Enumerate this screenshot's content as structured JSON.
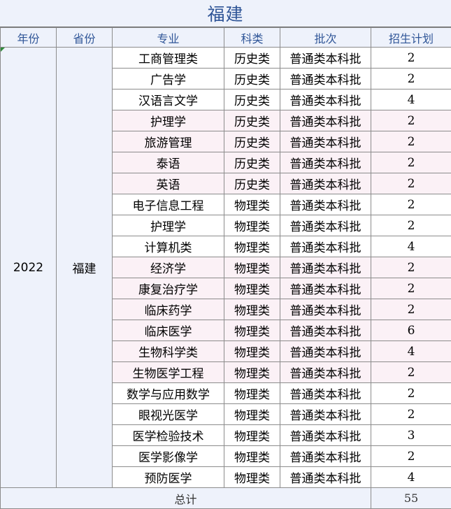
{
  "title": "福建",
  "headers": [
    "年份",
    "省份",
    "专业",
    "科类",
    "批次",
    "招生计划"
  ],
  "year": "2022",
  "province": "福建",
  "rows": [
    {
      "major": "工商管理类",
      "category": "历史类",
      "batch": "普通类本科批",
      "plan": "2",
      "shade": "white"
    },
    {
      "major": "广告学",
      "category": "历史类",
      "batch": "普通类本科批",
      "plan": "2",
      "shade": "white"
    },
    {
      "major": "汉语言文学",
      "category": "历史类",
      "batch": "普通类本科批",
      "plan": "4",
      "shade": "white"
    },
    {
      "major": "护理学",
      "category": "历史类",
      "batch": "普通类本科批",
      "plan": "2",
      "shade": "pink"
    },
    {
      "major": "旅游管理",
      "category": "历史类",
      "batch": "普通类本科批",
      "plan": "2",
      "shade": "pink"
    },
    {
      "major": "泰语",
      "category": "历史类",
      "batch": "普通类本科批",
      "plan": "2",
      "shade": "pink"
    },
    {
      "major": "英语",
      "category": "历史类",
      "batch": "普通类本科批",
      "plan": "2",
      "shade": "pink"
    },
    {
      "major": "电子信息工程",
      "category": "物理类",
      "batch": "普通类本科批",
      "plan": "2",
      "shade": "white"
    },
    {
      "major": "护理学",
      "category": "物理类",
      "batch": "普通类本科批",
      "plan": "2",
      "shade": "white"
    },
    {
      "major": "计算机类",
      "category": "物理类",
      "batch": "普通类本科批",
      "plan": "4",
      "shade": "white"
    },
    {
      "major": "经济学",
      "category": "物理类",
      "batch": "普通类本科批",
      "plan": "2",
      "shade": "pink"
    },
    {
      "major": "康复治疗学",
      "category": "物理类",
      "batch": "普通类本科批",
      "plan": "2",
      "shade": "pink"
    },
    {
      "major": "临床药学",
      "category": "物理类",
      "batch": "普通类本科批",
      "plan": "2",
      "shade": "pink"
    },
    {
      "major": "临床医学",
      "category": "物理类",
      "batch": "普通类本科批",
      "plan": "6",
      "shade": "pink"
    },
    {
      "major": "生物科学类",
      "category": "物理类",
      "batch": "普通类本科批",
      "plan": "4",
      "shade": "pink"
    },
    {
      "major": "生物医学工程",
      "category": "物理类",
      "batch": "普通类本科批",
      "plan": "2",
      "shade": "pink"
    },
    {
      "major": "数学与应用数学",
      "category": "物理类",
      "batch": "普通类本科批",
      "plan": "2",
      "shade": "white"
    },
    {
      "major": "眼视光医学",
      "category": "物理类",
      "batch": "普通类本科批",
      "plan": "2",
      "shade": "white"
    },
    {
      "major": "医学检验技术",
      "category": "物理类",
      "batch": "普通类本科批",
      "plan": "3",
      "shade": "white"
    },
    {
      "major": "医学影像学",
      "category": "物理类",
      "batch": "普通类本科批",
      "plan": "2",
      "shade": "white"
    },
    {
      "major": "预防医学",
      "category": "物理类",
      "batch": "普通类本科批",
      "plan": "4",
      "shade": "white"
    }
  ],
  "total": {
    "label": "总计",
    "value": "55"
  }
}
